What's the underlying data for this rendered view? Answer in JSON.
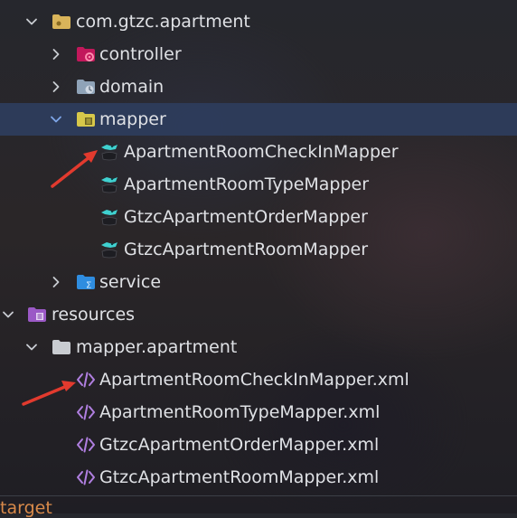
{
  "tree": {
    "package_root": "com.gtzc.apartment",
    "controller": "controller",
    "domain": "domain",
    "mapper": "mapper",
    "mapper_files": [
      "ApartmentRoomCheckInMapper",
      "ApartmentRoomTypeMapper",
      "GtzcApartmentOrderMapper",
      "GtzcApartmentRoomMapper"
    ],
    "service": "service",
    "resources": "resources",
    "mapper_apartment": "mapper.apartment",
    "xml_files": [
      "ApartmentRoomCheckInMapper.xml",
      "ApartmentRoomTypeMapper.xml",
      "GtzcApartmentOrderMapper.xml",
      "GtzcApartmentRoomMapper.xml"
    ],
    "target": "target"
  },
  "colors": {
    "selection": "#2d3c5c",
    "annotation_arrow": "#e23a2e",
    "package_folder": "#d9b45a",
    "java_interface_icon": "#3fd1d0",
    "xml_icon": "#b07fe0",
    "resources_folder": "#9b59c6",
    "target_text": "#d98a4a"
  },
  "icons": {
    "expanded": "chevron-down-icon",
    "collapsed": "chevron-right-icon",
    "package": "package-folder-icon",
    "controller": "controller-folder-icon",
    "domain": "domain-folder-icon",
    "mapper": "mapper-folder-icon",
    "service": "service-folder-icon",
    "resources": "resources-folder-icon",
    "plain_folder": "folder-icon",
    "mybatis_mapper": "mybatis-mapper-icon",
    "xml": "xml-file-icon"
  }
}
